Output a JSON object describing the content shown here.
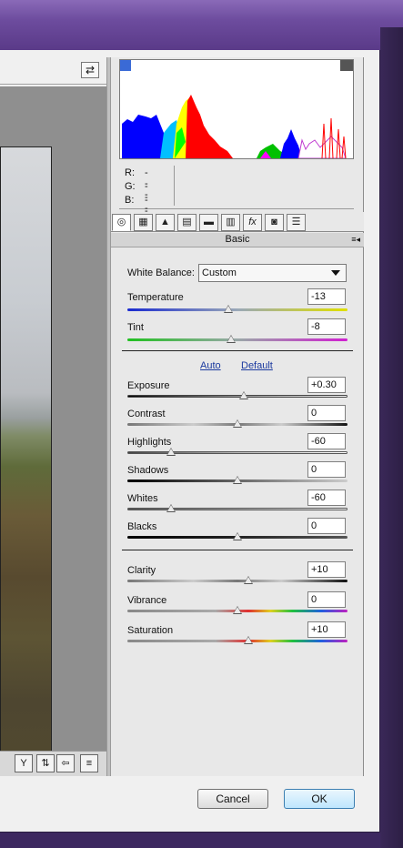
{
  "preview": {
    "toggle_icon": "before-after-toggle-icon"
  },
  "histogram": {
    "readout": {
      "r_label": "R:",
      "r_value": "---",
      "g_label": "G:",
      "g_value": "---",
      "b_label": "B:",
      "b_value": "---"
    }
  },
  "panel": {
    "section_title": "Basic",
    "white_balance": {
      "label": "White Balance:",
      "value": "Custom"
    },
    "temperature": {
      "label": "Temperature",
      "value": "-13",
      "pos": 0.46
    },
    "tint": {
      "label": "Tint",
      "value": "-8",
      "pos": 0.47
    },
    "auto_label": "Auto",
    "default_label": "Default",
    "exposure": {
      "label": "Exposure",
      "value": "+0.30",
      "pos": 0.53
    },
    "contrast": {
      "label": "Contrast",
      "value": "0",
      "pos": 0.5
    },
    "highlights": {
      "label": "Highlights",
      "value": "-60",
      "pos": 0.2
    },
    "shadows": {
      "label": "Shadows",
      "value": "0",
      "pos": 0.5
    },
    "whites": {
      "label": "Whites",
      "value": "-60",
      "pos": 0.2
    },
    "blacks": {
      "label": "Blacks",
      "value": "0",
      "pos": 0.5
    },
    "clarity": {
      "label": "Clarity",
      "value": "+10",
      "pos": 0.55
    },
    "vibrance": {
      "label": "Vibrance",
      "value": "0",
      "pos": 0.5
    },
    "saturation": {
      "label": "Saturation",
      "value": "+10",
      "pos": 0.55
    }
  },
  "buttons": {
    "cancel": "Cancel",
    "ok": "OK"
  },
  "tabs": [
    "basic-icon",
    "tone-curve-icon",
    "detail-icon",
    "hsl-icon",
    "split-toning-icon",
    "lens-icon",
    "fx-icon",
    "camera-calibration-icon",
    "presets-icon"
  ]
}
